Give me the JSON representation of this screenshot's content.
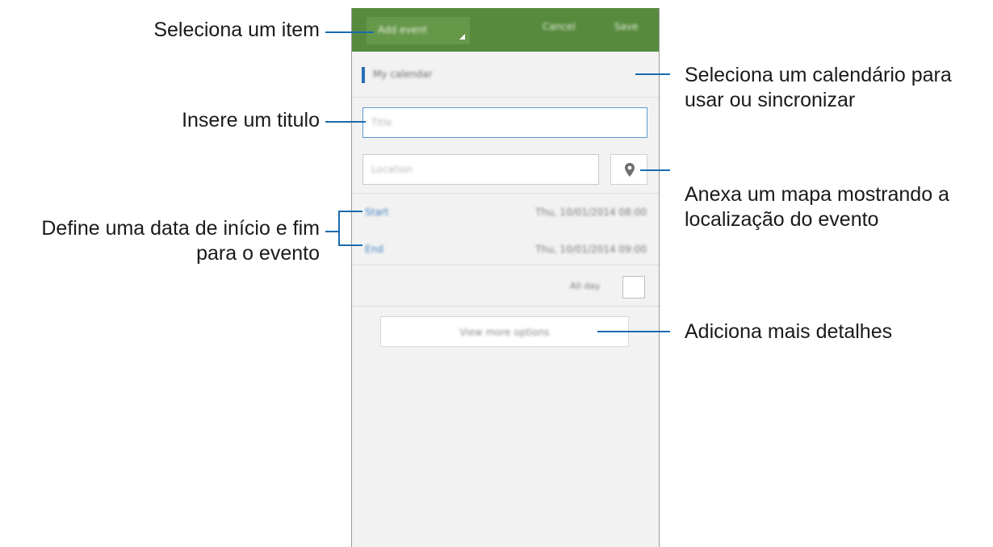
{
  "callouts": {
    "select_item": "Seleciona um item",
    "insert_title": "Insere um titulo",
    "date_line1": "Define uma data de início e fim",
    "date_line2": "para o evento",
    "calendar_line1": "Seleciona um calendário para",
    "calendar_line2": "usar ou sincronizar",
    "map_line1": "Anexa um mapa mostrando a",
    "map_line2": "localização do evento",
    "details": "Adiciona mais detalhes"
  },
  "app": {
    "spinner_label": "Add event",
    "cancel_label": "Cancel",
    "save_label": "Save",
    "calendar_name": "My calendar",
    "title_placeholder": "Title",
    "location_placeholder": "Location",
    "start_label": "Start",
    "start_value": "Thu, 10/01/2014   08:00",
    "end_label": "End",
    "end_value": "Thu, 10/01/2014   09:00",
    "allday_label": "All day",
    "more_options_label": "View more options"
  },
  "colors": {
    "action_bar": "#588a3e",
    "accent_blue": "#1a6bb0"
  },
  "icons": {
    "location": "map-pin-icon",
    "dropdown": "spinner-caret-icon"
  }
}
